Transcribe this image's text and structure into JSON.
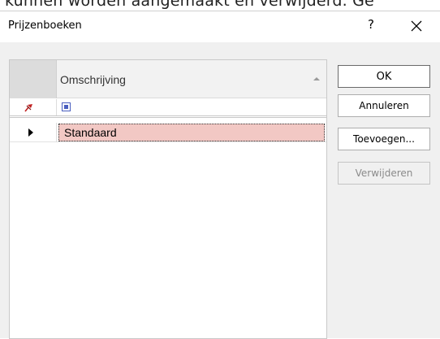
{
  "background_text": "kunnen worden aangemaakt en verwijderd. Ge",
  "window": {
    "title": "Prijzenboeken",
    "help_label": "?",
    "close_label": "✕"
  },
  "grid": {
    "column_header": "Omschrijving",
    "rows": [
      {
        "omschrijving": "Standaard",
        "selected": true
      }
    ],
    "selection_color": "#f2c8c4"
  },
  "buttons": {
    "ok": "OK",
    "annuleren": "Annuleren",
    "toevoegen": "Toevoegen...",
    "verwijderen": "Verwijderen",
    "verwijderen_disabled": true
  }
}
